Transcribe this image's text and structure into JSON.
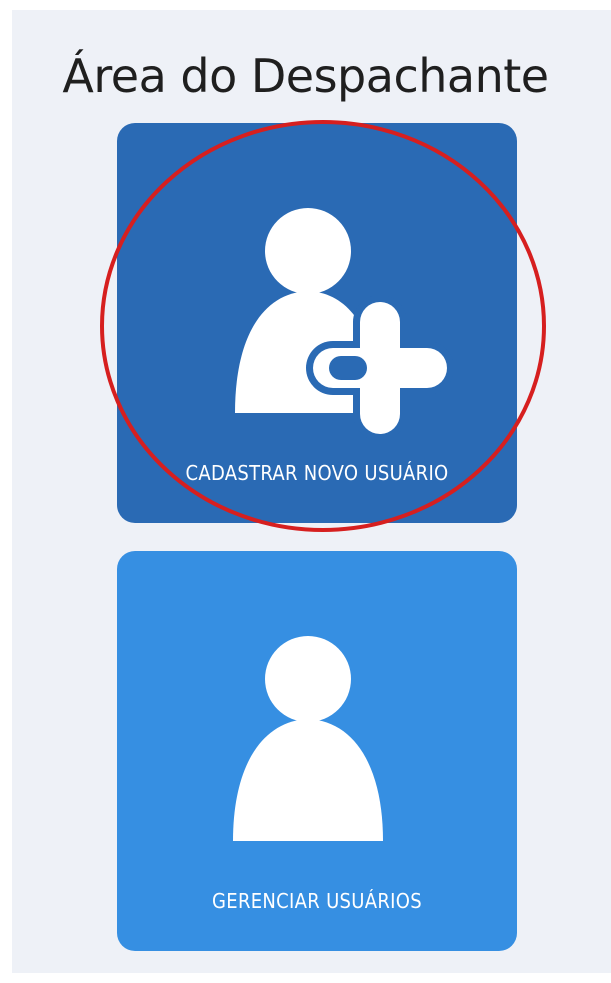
{
  "page": {
    "title": "Área do Despachante"
  },
  "tiles": [
    {
      "label": "CADASTRAR NOVO USUÁRIO",
      "icon": "user-plus-icon",
      "color": "#2a6ab4"
    },
    {
      "label": "GERENCIAR USUÁRIOS",
      "icon": "user-icon",
      "color": "#368fe2"
    }
  ],
  "colors": {
    "panel_background": "#eef1f7",
    "highlight": "#d61f1f",
    "icon": "#ffffff"
  }
}
